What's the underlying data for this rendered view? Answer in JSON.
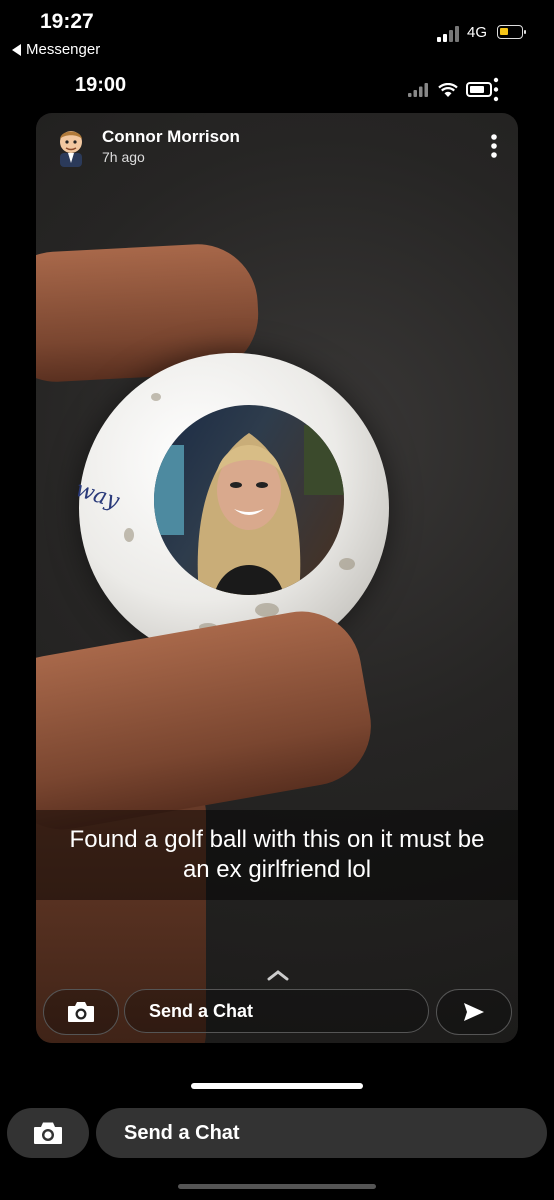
{
  "status_bar": {
    "time": "19:27",
    "back_label": "Messenger",
    "network": "4G"
  },
  "inner_status_bar": {
    "time": "19:00"
  },
  "snap": {
    "sender_name": "Connor Morrison",
    "sent_ago": "7h ago",
    "caption": "Found a golf ball with this on it must be an ex girlfriend lol",
    "ball_brand_text": "way",
    "chat_placeholder": "Send a Chat"
  },
  "bottom_bar": {
    "chat_placeholder": "Send a Chat"
  },
  "colors": {
    "battery_low": "#f5c518",
    "chat_pill_bg": "#333333"
  },
  "icons": [
    "chevron-left-icon",
    "signal-icon",
    "wifi-icon",
    "battery-icon",
    "more-vertical-icon",
    "camera-icon",
    "send-icon",
    "chevron-up-icon",
    "bitmoji-avatar-icon"
  ]
}
